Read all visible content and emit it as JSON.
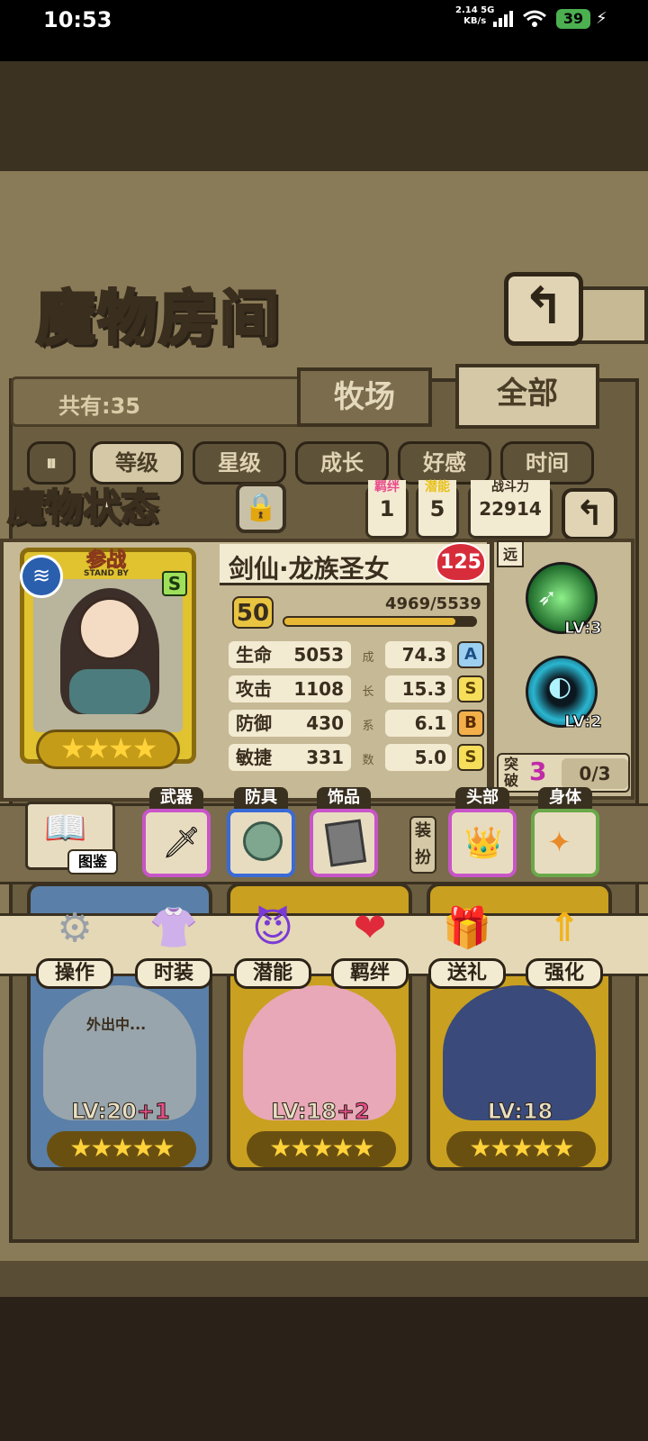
{
  "status_bar": {
    "time": "10:53",
    "net_speed": "2.14",
    "net_unit": "KB/s",
    "net_type": "5G",
    "battery": "39"
  },
  "header": {
    "title": "魔物房间",
    "total_count": "共有:35",
    "tabs": [
      "牧场",
      "全部"
    ]
  },
  "filters": {
    "items": [
      "等级",
      "星级",
      "成长",
      "好感",
      "时间"
    ],
    "active_index": 0
  },
  "monster_status": {
    "title": "魔物状态",
    "bond_label": "羁绊",
    "bond_value": "1",
    "potential_label": "潜能",
    "potential_value": "5",
    "power_label": "战斗力",
    "power_value": "22914",
    "standby_main": "参战",
    "standby_sub": "STAND BY",
    "grade": "S",
    "stars": "★★★★",
    "name": "剑仙·龙族圣女",
    "heart_value": "125",
    "level": "50",
    "exp_text": "4969/5539",
    "exp_fraction": 0.897,
    "growth_label": [
      "成",
      "长",
      "系",
      "数"
    ],
    "stats": [
      {
        "label": "生命",
        "value": "5053",
        "growth": "74.3",
        "rank": "A",
        "rank_color": "#3a8ad6"
      },
      {
        "label": "攻击",
        "value": "1108",
        "growth": "15.3",
        "rank": "S",
        "rank_color": "#e8c440"
      },
      {
        "label": "防御",
        "value": "430",
        "growth": "6.1",
        "rank": "B",
        "rank_color": "#e08a2a"
      },
      {
        "label": "敏捷",
        "value": "331",
        "growth": "5.0",
        "rank": "S",
        "rank_color": "#e8c440"
      }
    ],
    "range_label": "远",
    "skills": [
      {
        "lv": "LV:3",
        "icon": "wind-slash-icon"
      },
      {
        "lv": "LV:2",
        "icon": "vortex-icon"
      }
    ],
    "breakthrough_label": "突破",
    "breakthrough_value": "3",
    "breakthrough_progress": "0/3"
  },
  "equipment": {
    "codex_label": "图鉴",
    "slots": [
      {
        "label": "武器",
        "border": "#c855c8"
      },
      {
        "label": "防具",
        "border": "#3a6ad6"
      },
      {
        "label": "饰品",
        "border": "#c855c8"
      }
    ],
    "dress_label": "装扮",
    "dress_slots": [
      {
        "label": "头部",
        "border": "#c855c8"
      },
      {
        "label": "身体",
        "border": "#6aa84a"
      }
    ]
  },
  "actions": [
    {
      "label": "操作",
      "icon": "gear-icon"
    },
    {
      "label": "时装",
      "icon": "outfit-icon"
    },
    {
      "label": "潜能",
      "icon": "demon-icon"
    },
    {
      "label": "羁绊",
      "icon": "hearts-icon"
    },
    {
      "label": "送礼",
      "icon": "gift-icon"
    },
    {
      "label": "强化",
      "icon": "upgrade-arrow-icon"
    }
  ],
  "cards": [
    {
      "lv": "LV:20",
      "plus": "+1",
      "away": "外出中...",
      "stars": "★★★★★",
      "color": "#5a7fa8"
    },
    {
      "lv": "LV:18",
      "plus": "+2",
      "away": "",
      "stars": "★★★★★",
      "color": "#c9a020"
    },
    {
      "lv": "LV:18",
      "plus": "",
      "away": "",
      "stars": "★★★★★",
      "color": "#c9a020"
    }
  ]
}
